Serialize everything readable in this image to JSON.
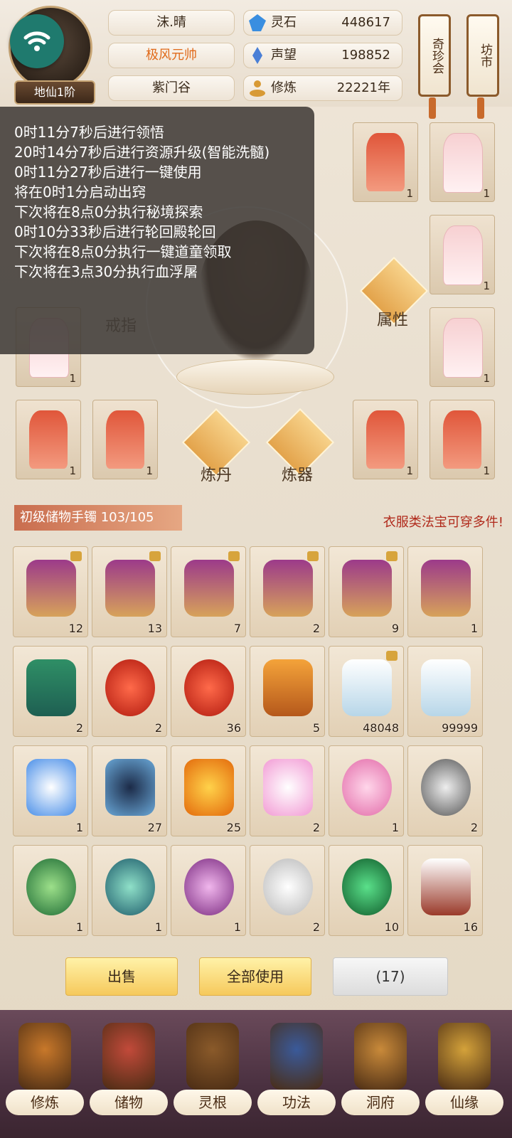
{
  "player": {
    "rank": "地仙1阶",
    "name": "沫.晴",
    "title": "极风元帅",
    "sect": "紫门谷"
  },
  "stats": [
    {
      "label": "灵石",
      "value": "448617",
      "icon": "spirit-stone-icon",
      "color": "#3a8ee0"
    },
    {
      "label": "声望",
      "value": "198852",
      "icon": "prestige-crystal-icon",
      "color": "#4a7fd6"
    },
    {
      "label": "修炼",
      "value": "22221年",
      "icon": "cultivation-meditate-icon",
      "color": "#d89a35"
    }
  ],
  "scrolls": {
    "treasure": "奇珍会",
    "market": "坊市"
  },
  "log": {
    "lines": [
      "0时11分7秒后进行领悟",
      "20时14分7秒后进行资源升级(智能洗髓)",
      "0时11分27秒后进行一键使用",
      "将在0时1分启动出窍",
      "下次将在8点0分执行秘境探索",
      "0时10分33秒后进行轮回殿轮回",
      "下次将在8点0分执行一键道童领取",
      "下次将在3点30分执行血浮屠"
    ]
  },
  "equipment": {
    "ring_label": "戒指",
    "attribute_label": "属性",
    "alchemy_label": "炼丹",
    "forge_label": "炼器",
    "slots": [
      {
        "count": "1",
        "robe": "red"
      },
      {
        "count": "1",
        "robe": "pink"
      },
      {
        "count": "1",
        "robe": "pink"
      },
      {
        "count": "1",
        "robe": "pink"
      },
      {
        "count": "1",
        "robe": "pink"
      },
      {
        "count": "1",
        "robe": "red"
      },
      {
        "count": "1",
        "robe": "red"
      },
      {
        "count": "1",
        "robe": "red"
      },
      {
        "count": "1",
        "robe": "red"
      }
    ]
  },
  "bag": {
    "title": "初级储物手镯 103/105",
    "tip": "衣服类法宝可穿多件!",
    "items": [
      {
        "count": "12",
        "icon": "scroll-drum-icon",
        "locked": true
      },
      {
        "count": "13",
        "icon": "scroll-drum-icon",
        "locked": true
      },
      {
        "count": "7",
        "icon": "scroll-drum-icon",
        "locked": true
      },
      {
        "count": "2",
        "icon": "scroll-drum-icon",
        "locked": true
      },
      {
        "count": "9",
        "icon": "scroll-drum-icon",
        "locked": true
      },
      {
        "count": "1",
        "icon": "scroll-drum-icon",
        "locked": false
      },
      {
        "count": "2",
        "icon": "green-gourd-icon",
        "locked": false
      },
      {
        "count": "2",
        "icon": "red-pearl-icon",
        "locked": false
      },
      {
        "count": "36",
        "icon": "red-pearl-icon",
        "locked": false
      },
      {
        "count": "5",
        "icon": "orange-gourd-icon",
        "locked": false
      },
      {
        "count": "48048",
        "icon": "porcelain-vase-icon",
        "locked": true
      },
      {
        "count": "99999",
        "icon": "porcelain-vase-icon",
        "locked": false
      },
      {
        "count": "1",
        "icon": "tea-cup-icon",
        "locked": false
      },
      {
        "count": "27",
        "icon": "star-chart-icon",
        "locked": false
      },
      {
        "count": "25",
        "icon": "amber-gem-icon",
        "locked": false
      },
      {
        "count": "2",
        "icon": "lotus-icon",
        "locked": false
      },
      {
        "count": "1",
        "icon": "pink-egg-icon",
        "locked": false
      },
      {
        "count": "2",
        "icon": "skull-egg-gray-icon",
        "locked": false
      },
      {
        "count": "1",
        "icon": "skull-egg-green-icon",
        "locked": false
      },
      {
        "count": "1",
        "icon": "skull-egg-teal-icon",
        "locked": false
      },
      {
        "count": "1",
        "icon": "skull-egg-purple-icon",
        "locked": false
      },
      {
        "count": "2",
        "icon": "white-swirl-orb-icon",
        "locked": false
      },
      {
        "count": "10",
        "icon": "green-swirl-orb-icon",
        "locked": false
      },
      {
        "count": "16",
        "icon": "rice-box-icon",
        "locked": false
      }
    ]
  },
  "actions": {
    "sell": "出售",
    "use_all": "全部使用",
    "selected": "(17)"
  },
  "nav": [
    {
      "label": "修炼",
      "icon": "cultivate-nav-icon"
    },
    {
      "label": "储物",
      "icon": "storage-bag-nav-icon"
    },
    {
      "label": "灵根",
      "icon": "spirit-root-nav-icon"
    },
    {
      "label": "功法",
      "icon": "technique-book-nav-icon"
    },
    {
      "label": "洞府",
      "icon": "cave-house-nav-icon"
    },
    {
      "label": "仙缘",
      "icon": "fate-gourd-nav-icon"
    }
  ]
}
